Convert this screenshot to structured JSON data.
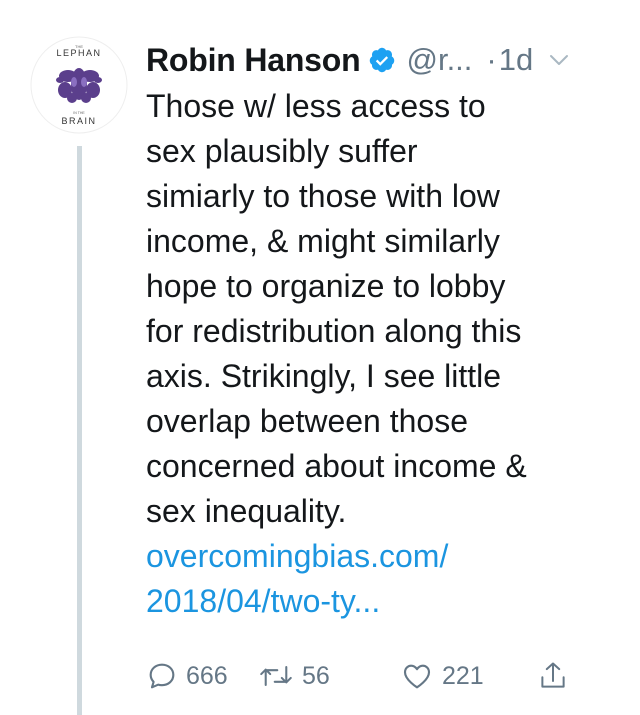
{
  "tweet": {
    "author": {
      "display_name": "Robin Hanson",
      "handle": "@r...",
      "verified": true,
      "avatar": {
        "icon": "book-cover-avatar",
        "title_top": "THE",
        "title_main": "LEPHAN",
        "title_sub": "IN THE",
        "title_bottom": "BRAIN"
      }
    },
    "separator": "·",
    "timestamp": "1d",
    "body_lines": [
      "Those w/ less access to",
      "sex plausibly suffer",
      "simiarly to those with low",
      "income, & might similarly",
      "hope to organize to lobby",
      "for redistribution along this",
      "axis. Strikingly, I see little",
      "overlap between those",
      "concerned about income &",
      "sex inequality."
    ],
    "link_lines": [
      "overcomingbias.com/",
      "2018/04/two-ty..."
    ],
    "actions": {
      "reply_count": "666",
      "retweet_count": "56",
      "like_count": "221"
    },
    "colors": {
      "text": "#14171a",
      "secondary": "#657786",
      "link": "#1b95e0",
      "verified": "#1da1f2",
      "thread_line": "#cfd9de"
    }
  }
}
